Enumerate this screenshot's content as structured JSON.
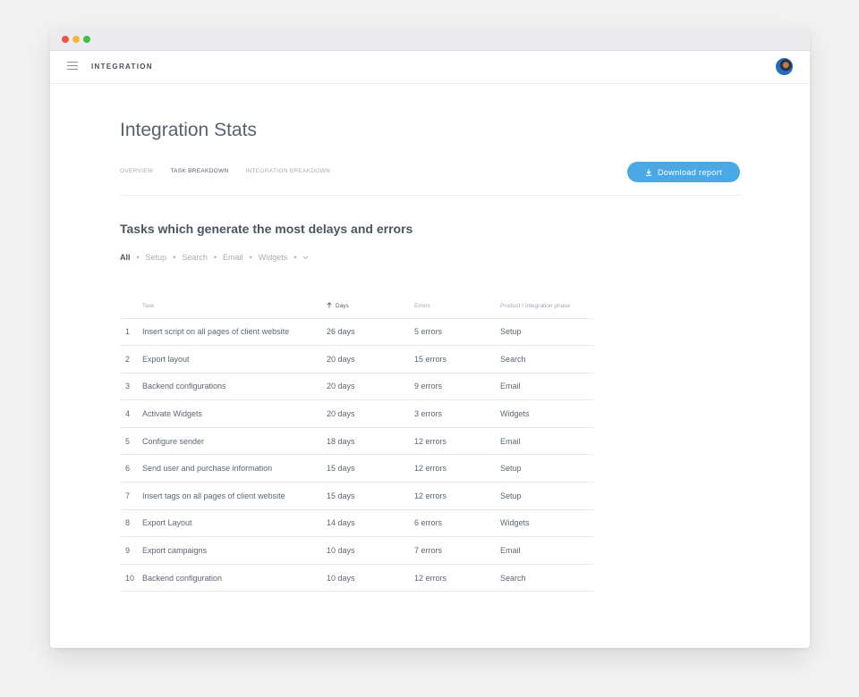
{
  "app": {
    "name": "INTEGRATION"
  },
  "page": {
    "title": "Integration Stats"
  },
  "tabs": [
    {
      "label": "OVERVIEW"
    },
    {
      "label": "TASK BREAKDOWN"
    },
    {
      "label": "INTEGRATION BREAKDOWN"
    }
  ],
  "actions": {
    "download_label": "Download report"
  },
  "section": {
    "title": "Tasks which generate the most delays and errors"
  },
  "filters": [
    {
      "label": "All"
    },
    {
      "label": "Setup"
    },
    {
      "label": "Search"
    },
    {
      "label": "Email"
    },
    {
      "label": "Widgets"
    }
  ],
  "table": {
    "headers": {
      "task": "Task",
      "days": "Days",
      "errors": "Errors",
      "phase": "Product / Integration phase"
    },
    "rows": [
      {
        "num": "1",
        "task": "Insert script on all pages of client website",
        "days": "26 days",
        "errors": "5 errors",
        "phase": "Setup"
      },
      {
        "num": "2",
        "task": "Export layout",
        "days": "20 days",
        "errors": "15 errors",
        "phase": "Search"
      },
      {
        "num": "3",
        "task": "Backend configurations",
        "days": "20 days",
        "errors": "9 errors",
        "phase": "Email"
      },
      {
        "num": "4",
        "task": "Activate Widgets",
        "days": "20 days",
        "errors": "3 errors",
        "phase": "Widgets"
      },
      {
        "num": "5",
        "task": "Configure sender",
        "days": "18 days",
        "errors": "12 errors",
        "phase": "Email"
      },
      {
        "num": "6",
        "task": "Send user and purchase information",
        "days": "15 days",
        "errors": "12 errors",
        "phase": "Setup"
      },
      {
        "num": "7",
        "task": "Insert tags on all pages of client website",
        "days": "15 days",
        "errors": "12 errors",
        "phase": "Setup"
      },
      {
        "num": "8",
        "task": "Export Layout",
        "days": "14 days",
        "errors": "6 errors",
        "phase": "Widgets"
      },
      {
        "num": "9",
        "task": "Export campaigns",
        "days": "10 days",
        "errors": "7 errors",
        "phase": "Email"
      },
      {
        "num": "10",
        "task": "Backend configuration",
        "days": "10 days",
        "errors": "12 errors",
        "phase": "Search"
      }
    ]
  },
  "colors": {
    "accent": "#4aa8e6",
    "text": "#5a616d",
    "muted": "#a6abb3"
  }
}
